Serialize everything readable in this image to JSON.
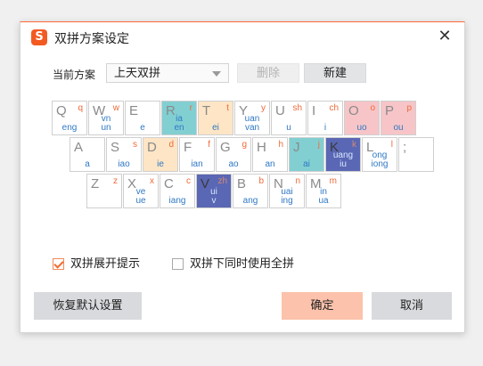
{
  "title": "双拼方案设定",
  "app_icon_glyph": "S",
  "close_glyph": "✕",
  "scheme": {
    "label": "当前方案",
    "selected": "上天双拼",
    "delete_label": "删除",
    "new_label": "新建"
  },
  "keyboard": {
    "rows": [
      [
        {
          "letter": "Q",
          "shengmu": "q",
          "yunmu": "eng",
          "color": "white"
        },
        {
          "letter": "W",
          "shengmu": "w",
          "yunmu": "vn\nun",
          "color": "white"
        },
        {
          "letter": "E",
          "shengmu": "",
          "yunmu": "e",
          "color": "white"
        },
        {
          "letter": "R",
          "shengmu": "r",
          "yunmu": "ia\nen",
          "color": "teal"
        },
        {
          "letter": "T",
          "shengmu": "t",
          "yunmu": "ei",
          "color": "peach"
        },
        {
          "letter": "Y",
          "shengmu": "y",
          "yunmu": "uan\nvan",
          "color": "white"
        },
        {
          "letter": "U",
          "shengmu": "sh",
          "yunmu": "u",
          "color": "white"
        },
        {
          "letter": "I",
          "shengmu": "ch",
          "yunmu": "i",
          "color": "white"
        },
        {
          "letter": "O",
          "shengmu": "o",
          "yunmu": "uo",
          "color": "pink"
        },
        {
          "letter": "P",
          "shengmu": "p",
          "yunmu": "ou",
          "color": "pink"
        }
      ],
      [
        {
          "letter": "A",
          "shengmu": "",
          "yunmu": "a",
          "color": "white"
        },
        {
          "letter": "S",
          "shengmu": "s",
          "yunmu": "iao",
          "color": "white"
        },
        {
          "letter": "D",
          "shengmu": "d",
          "yunmu": "ie",
          "color": "peach"
        },
        {
          "letter": "F",
          "shengmu": "f",
          "yunmu": "ian",
          "color": "white"
        },
        {
          "letter": "G",
          "shengmu": "g",
          "yunmu": "ao",
          "color": "white"
        },
        {
          "letter": "H",
          "shengmu": "h",
          "yunmu": "an",
          "color": "white"
        },
        {
          "letter": "J",
          "shengmu": "j",
          "yunmu": "ai",
          "color": "teal"
        },
        {
          "letter": "K",
          "shengmu": "k",
          "yunmu": "uang\niu",
          "color": "navy"
        },
        {
          "letter": "L",
          "shengmu": "l",
          "yunmu": "ong\niong",
          "color": "white"
        },
        {
          "letter": ";",
          "shengmu": "",
          "yunmu": "",
          "color": "white"
        }
      ],
      [
        {
          "letter": "Z",
          "shengmu": "z",
          "yunmu": "",
          "color": "white"
        },
        {
          "letter": "X",
          "shengmu": "x",
          "yunmu": "ve\nue",
          "color": "white"
        },
        {
          "letter": "C",
          "shengmu": "c",
          "yunmu": "iang",
          "color": "white"
        },
        {
          "letter": "V",
          "shengmu": "zh",
          "yunmu": "ui\nv",
          "color": "navy"
        },
        {
          "letter": "B",
          "shengmu": "b",
          "yunmu": "ang",
          "color": "white"
        },
        {
          "letter": "N",
          "shengmu": "n",
          "yunmu": "uai\ning",
          "color": "white"
        },
        {
          "letter": "M",
          "shengmu": "m",
          "yunmu": "in\nua",
          "color": "white"
        }
      ]
    ]
  },
  "options": {
    "expand_hint": {
      "label": "双拼展开提示",
      "checked": true
    },
    "allow_full": {
      "label": "双拼下同时使用全拼",
      "checked": false
    }
  },
  "buttons": {
    "restore": "恢复默认设置",
    "ok": "确定",
    "cancel": "取消"
  },
  "colors": {
    "accent": "#f25a22",
    "teal": "#82cfd2",
    "peach": "#fde5c6",
    "pink": "#f7c5c8",
    "navy": "#5a67b4",
    "ok_button": "#fcc2ab"
  }
}
